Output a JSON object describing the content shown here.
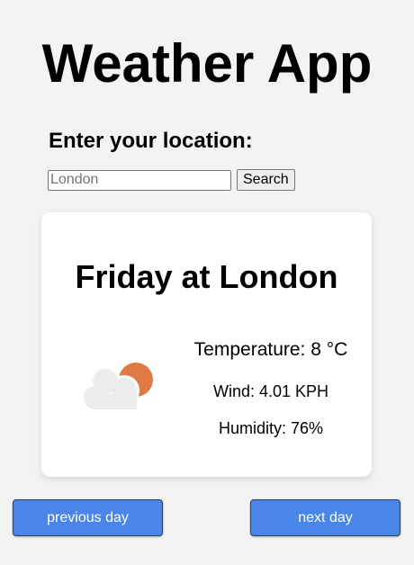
{
  "header": {
    "title": "Weather App"
  },
  "search": {
    "label": "Enter your location:",
    "placeholder": "London",
    "value": "",
    "button_label": "Search"
  },
  "weather": {
    "title": "Friday at London",
    "icon": "partly-cloudy-icon",
    "temperature": "Temperature: 8 °C",
    "wind": "Wind: 4.01 KPH",
    "humidity": "Humidity: 76%"
  },
  "navigation": {
    "previous_label": "previous day",
    "next_label": "next day"
  },
  "colors": {
    "page_background": "#f3f3f3",
    "card_background": "#ffffff",
    "nav_button_background": "#4a86e8",
    "sun": "#e07a45",
    "cloud": "#ececec"
  }
}
